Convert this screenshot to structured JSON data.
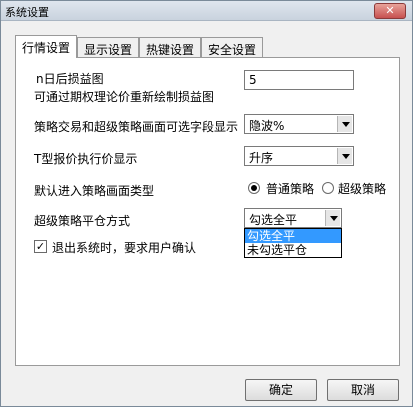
{
  "window": {
    "title": "系统设置",
    "close_label": "✕"
  },
  "tabs": [
    {
      "label": "行情设置",
      "active": true
    },
    {
      "label": "显示设置",
      "active": false
    },
    {
      "label": "热键设置",
      "active": false
    },
    {
      "label": "安全设置",
      "active": false
    }
  ],
  "settings": {
    "n_day_label": "n日后损益图",
    "n_day_sub": "可通过期权理论价重新绘制损益图",
    "n_day_value": "5",
    "fields_label": "策略交易和超级策略画面可选字段显示",
    "fields_value": "隐波%",
    "t_quote_label": "T型报价执行价显示",
    "t_quote_value": "升序",
    "default_view_label": "默认进入策略画面类型",
    "radio_normal": "普通策略",
    "radio_super": "超级策略",
    "radio_selected": "normal",
    "close_mode_label": "超级策略平仓方式",
    "close_mode_value": "勾选全平",
    "close_mode_options": [
      "勾选全平",
      "未勾选平仓"
    ],
    "confirm_exit_label": "退出系统时，要求用户确认",
    "confirm_exit_checked": true
  },
  "buttons": {
    "ok": "确定",
    "cancel": "取消"
  }
}
